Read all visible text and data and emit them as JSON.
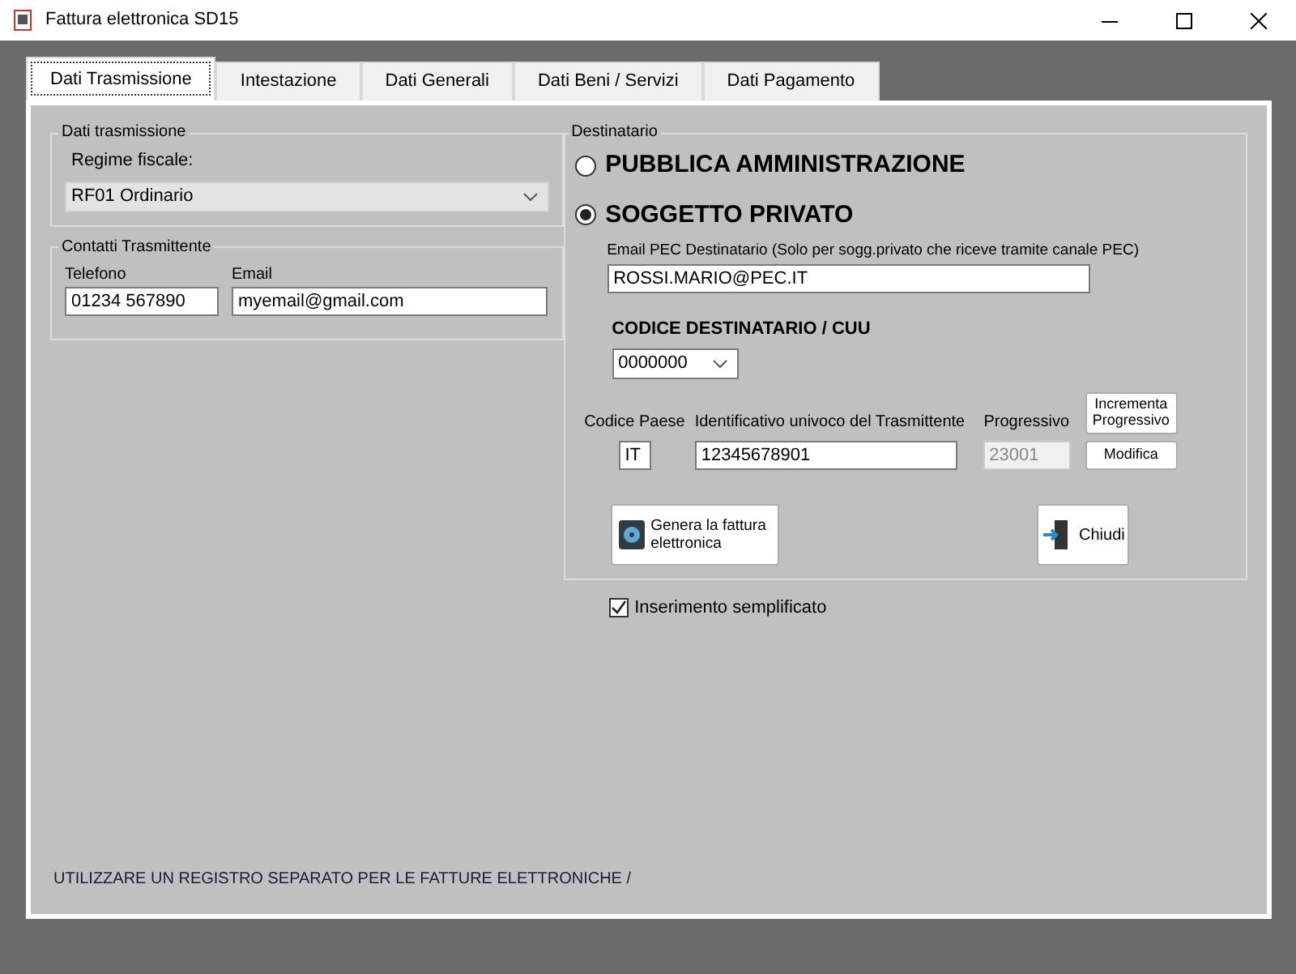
{
  "window": {
    "title": "Fattura elettronica SD15"
  },
  "tabs": [
    {
      "label": "Dati Trasmissione",
      "selected": true
    },
    {
      "label": "Intestazione",
      "selected": false
    },
    {
      "label": "Dati Generali",
      "selected": false
    },
    {
      "label": "Dati Beni / Servizi",
      "selected": false
    },
    {
      "label": "Dati Pagamento",
      "selected": false
    }
  ],
  "dati_trasmissione": {
    "legend": "Dati trasmissione",
    "regime_fiscale": {
      "label": "Regime fiscale:",
      "value": "RF01 Ordinario"
    }
  },
  "contatti": {
    "legend": "Contatti Trasmittente",
    "telefono": {
      "label": "Telefono",
      "value": "01234 567890"
    },
    "email": {
      "label": "Email",
      "value": "myemail@gmail.com"
    }
  },
  "destinatario": {
    "legend": "Destinatario",
    "options": [
      {
        "label": "PUBBLICA AMMINISTRAZIONE",
        "selected": false
      },
      {
        "label": "SOGGETTO PRIVATO",
        "selected": true
      }
    ],
    "pec": {
      "label": "Email PEC Destinatario (Solo per sogg.privato che riceve tramite canale PEC)",
      "value": "ROSSI.MARIO@PEC.IT"
    },
    "codice": {
      "label": "CODICE DESTINATARIO / CUU",
      "value": "0000000"
    },
    "codice_paese": {
      "label": "Codice Paese",
      "value": "IT"
    },
    "identificativo": {
      "label": "Identificativo univoco del Trasmittente",
      "value": "12345678901"
    },
    "progressivo": {
      "label": "Progressivo",
      "value": "23001",
      "disabled": true
    },
    "incrementa_button": "Incrementa Progressivo",
    "modifica_button": "Modifica",
    "genera_button": "Genera la fattura elettronica",
    "chiudi_button": "Chiudi"
  },
  "inserimento": {
    "label": "Inserimento semplificato",
    "checked": true
  },
  "footer_note": "UTILIZZARE UN REGISTRO SEPARATO PER LE FATTURE ELETTRONICHE /"
}
